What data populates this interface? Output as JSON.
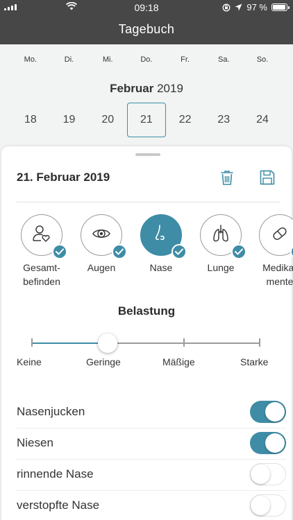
{
  "status_bar": {
    "time": "09:18",
    "battery": "97 %",
    "battery_level": 0.97
  },
  "header": {
    "title": "Tagebuch"
  },
  "calendar": {
    "weekdays": [
      "Mo.",
      "Di.",
      "Mi.",
      "Do.",
      "Fr.",
      "Sa.",
      "So."
    ],
    "month_name": "Februar",
    "year": "2019",
    "dates": [
      "18",
      "19",
      "20",
      "21",
      "22",
      "23",
      "24"
    ],
    "selected_index": 3
  },
  "entry": {
    "date": "21. Februar 2019",
    "categories": [
      {
        "label": "Gesamt-\nbefinden",
        "icon": "person-heart-icon",
        "checked": true,
        "active": false
      },
      {
        "label": "Augen",
        "icon": "eye-icon",
        "checked": true,
        "active": false
      },
      {
        "label": "Nase",
        "icon": "nose-icon",
        "checked": true,
        "active": true
      },
      {
        "label": "Lunge",
        "icon": "lungs-icon",
        "checked": true,
        "active": false
      },
      {
        "label": "Medika-\nmente",
        "icon": "pill-icon",
        "checked": true,
        "active": false
      }
    ],
    "belastung": {
      "title": "Belastung",
      "levels": [
        "Keine",
        "Geringe",
        "Mäßige",
        "Starke"
      ],
      "selected": "Geringe"
    },
    "symptoms": [
      {
        "label": "Nasenjucken",
        "on": true
      },
      {
        "label": "Niesen",
        "on": true
      },
      {
        "label": "rinnende Nase",
        "on": false
      },
      {
        "label": "verstopfte Nase",
        "on": false
      }
    ]
  },
  "colors": {
    "accent": "#3f8ca6",
    "header_bg": "#474747"
  }
}
